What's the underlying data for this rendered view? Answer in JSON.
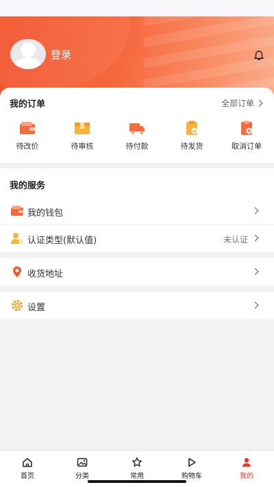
{
  "header": {
    "login_label": "登录",
    "accent_color": "#f2552d"
  },
  "orders": {
    "title": "我的订单",
    "all_orders_label": "全部订单",
    "items": [
      {
        "label": "待改价",
        "icon": "wallet-icon"
      },
      {
        "label": "待审核",
        "icon": "package-icon"
      },
      {
        "label": "待付款",
        "icon": "truck-icon"
      },
      {
        "label": "待发货",
        "icon": "clipboard-check-icon"
      },
      {
        "label": "取消订单",
        "icon": "clipboard-cancel-icon"
      }
    ]
  },
  "services": {
    "title": "我的服务",
    "wallet_label": "我的钱包",
    "verify_label": "认证类型(默认值)",
    "verify_value": "未认证"
  },
  "address": {
    "label": "收货地址"
  },
  "settings": {
    "label": "设置"
  },
  "tabbar": {
    "active_color": "#e8382a",
    "tabs": [
      {
        "label": "首页",
        "icon": "home-icon"
      },
      {
        "label": "分类",
        "icon": "image-icon"
      },
      {
        "label": "常用",
        "icon": "star-icon"
      },
      {
        "label": "购物车",
        "icon": "play-icon"
      },
      {
        "label": "我的",
        "icon": "user-icon",
        "active": true
      }
    ]
  }
}
